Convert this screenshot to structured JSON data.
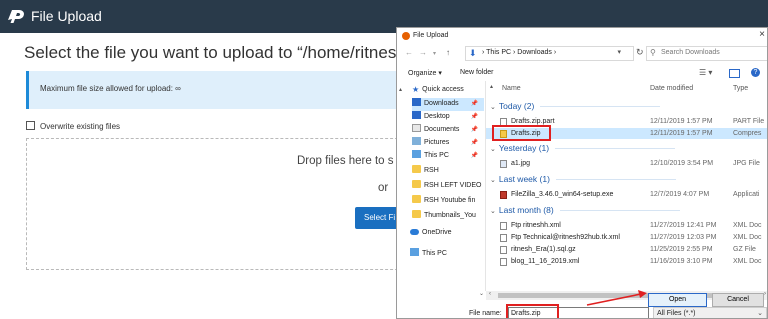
{
  "app": {
    "title": "File Upload",
    "heading": "Select the file you want to upload to “/home/ritneshh",
    "max_size_text": "Maximum file size allowed for upload: ∞",
    "overwrite_label": "Overwrite existing files",
    "drop_text": "Drop files here to s",
    "or_text": "or",
    "select_button": "Select Fi"
  },
  "dialog": {
    "title": "File Upload",
    "close": "×",
    "back": "←",
    "forward": "→",
    "up": "↑",
    "path": "›  This PC  ›  Downloads  ›",
    "search_placeholder": "Search Downloads",
    "organize": "Organize ▾",
    "new_folder": "New folder",
    "help": "?",
    "nav_items": [
      {
        "label": "Quick access",
        "icon": "star-icon"
      },
      {
        "label": "Downloads",
        "icon": "download-icon"
      },
      {
        "label": "Desktop",
        "icon": "folder-icon"
      },
      {
        "label": "Documents",
        "icon": "folder-icon"
      },
      {
        "label": "Pictures",
        "icon": "folder-icon"
      },
      {
        "label": "This PC",
        "icon": "pc-icon"
      },
      {
        "label": "RSH",
        "icon": "folder-icon"
      },
      {
        "label": "RSH LEFT VIDEO",
        "icon": "folder-icon"
      },
      {
        "label": "RSH Youtube fin",
        "icon": "folder-icon"
      },
      {
        "label": "Thumbnails_You",
        "icon": "folder-icon"
      },
      {
        "label": "OneDrive",
        "icon": "cloud-icon"
      },
      {
        "label": "This PC",
        "icon": "pc-icon"
      }
    ],
    "columns": {
      "name": "Name",
      "date": "Date modified",
      "type": "Type"
    },
    "groups": [
      {
        "label": "Today (2)"
      },
      {
        "label": "Yesterday (1)"
      },
      {
        "label": "Last week (1)"
      },
      {
        "label": "Last month (8)"
      }
    ],
    "files": [
      {
        "name": "Drafts.zip.part",
        "date": "12/11/2019 1:57 PM",
        "type": "PART File"
      },
      {
        "name": "Drafts.zip",
        "date": "12/11/2019 1:57 PM",
        "type": "Compres"
      },
      {
        "name": "a1.jpg",
        "date": "12/10/2019 3:54 PM",
        "type": "JPG File"
      },
      {
        "name": "FileZilla_3.46.0_win64-setup.exe",
        "date": "12/7/2019 4:07 PM",
        "type": "Applicati"
      },
      {
        "name": "Ftp ritneshh.xml",
        "date": "11/27/2019 12:41 PM",
        "type": "XML Doc"
      },
      {
        "name": "Ftp Technical@ritnesh92hub.tk.xml",
        "date": "11/27/2019 12:03 PM",
        "type": "XML Doc"
      },
      {
        "name": "ritnesh_Era(1).sql.gz",
        "date": "11/25/2019 2:55 PM",
        "type": "GZ File"
      },
      {
        "name": "blog_11_16_2019.xml",
        "date": "11/16/2019 3:10 PM",
        "type": "XML Doc"
      }
    ],
    "file_name_label": "File name:",
    "file_name_value": "Drafts.zip",
    "filter_value": "All Files (*.*)",
    "open_button": "Open",
    "cancel_button": "Cancel"
  },
  "colors": {
    "header_bg": "#293a4a",
    "accent": "#1a6fc0",
    "highlight": "#e02020",
    "selection": "#cce8ff"
  }
}
